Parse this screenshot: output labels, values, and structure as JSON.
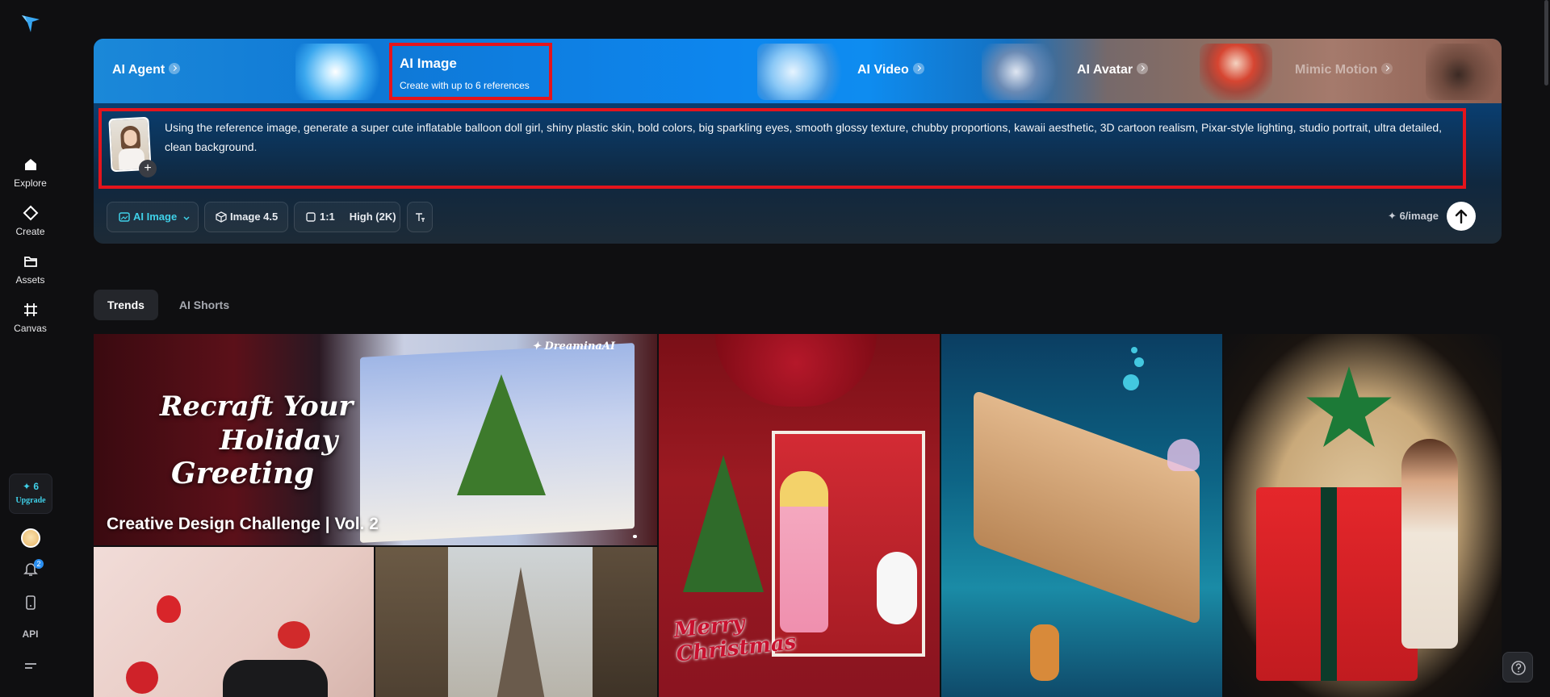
{
  "sidebar": {
    "items": [
      {
        "label": "Explore",
        "icon": "home-icon"
      },
      {
        "label": "Create",
        "icon": "diamond-icon"
      },
      {
        "label": "Assets",
        "icon": "folder-icon"
      },
      {
        "label": "Canvas",
        "icon": "canvas-icon"
      }
    ],
    "credits": "6",
    "upgrade_label": "Upgrade",
    "notification_count": "2",
    "api_label": "API"
  },
  "hero": {
    "tabs": [
      {
        "label": "AI Agent"
      },
      {
        "label": "AI Image",
        "subtitle": "Create with up to 6 references",
        "active": true
      },
      {
        "label": "AI Video"
      },
      {
        "label": "AI Avatar"
      },
      {
        "label": "Mimic Motion"
      }
    ],
    "prompt_text": "Using the reference image, generate a  super cute inflatable balloon doll girl, shiny plastic skin, bold colors, big sparkling eyes, smooth glossy texture, chubby proportions, kawaii aesthetic, 3D cartoon realism, Pixar-style lighting, studio portrait, ultra detailed, clean background.",
    "toolbar": {
      "mode_label": "AI Image",
      "model_label": "Image 4.5",
      "ratio_label": "1:1",
      "quality_label": "High (2K)",
      "cost_label": "6/image"
    }
  },
  "feed": {
    "tabs": [
      {
        "label": "Trends",
        "active": true
      },
      {
        "label": "AI Shorts",
        "active": false
      }
    ],
    "banner": {
      "script_line1": "Recraft Your",
      "script_line2": "Holiday",
      "script_line3": "Greeting",
      "brand": "DreaminaAI",
      "title": "Creative Design Challenge | Vol. 2"
    },
    "card_christmas": {
      "text_line1": "Merry",
      "text_line2": "Christmas"
    }
  },
  "colors": {
    "accent": "#3fd0e8",
    "highlight_border": "#e5141c",
    "background": "#0f0f11"
  }
}
